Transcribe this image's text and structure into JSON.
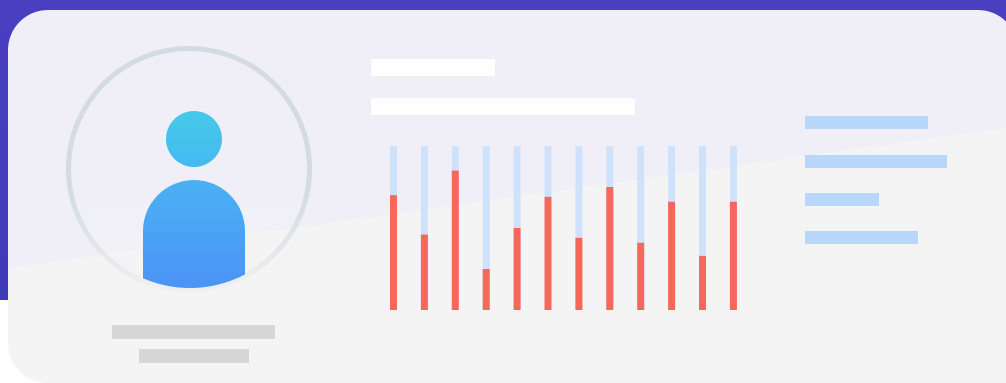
{
  "colors": {
    "background_band": "#4a3fc0",
    "card_top": "#f0eff8",
    "card_bottom": "#f4f4f4",
    "ring": "#d4dbe2",
    "avatar_head": "#46c9ea",
    "avatar_body_top": "#4ab1f3",
    "avatar_body_bottom": "#4d8df7",
    "placeholder_gray": "#d6d6d6",
    "placeholder_white": "#ffffff",
    "bar_track": "#cfe2fb",
    "bar_fill": "#f6685b",
    "legend_bar": "#b9d6fb"
  },
  "icons": {
    "avatar": "user-avatar-icon"
  },
  "chart_data": {
    "type": "bar",
    "categories": [
      "",
      "",
      "",
      "",
      "",
      "",
      "",
      "",
      "",
      "",
      "",
      ""
    ],
    "values": [
      70,
      46,
      85,
      25,
      50,
      69,
      44,
      75,
      41,
      66,
      33,
      66
    ],
    "ylim": [
      0,
      100
    ],
    "grid": false,
    "legend": "none"
  }
}
